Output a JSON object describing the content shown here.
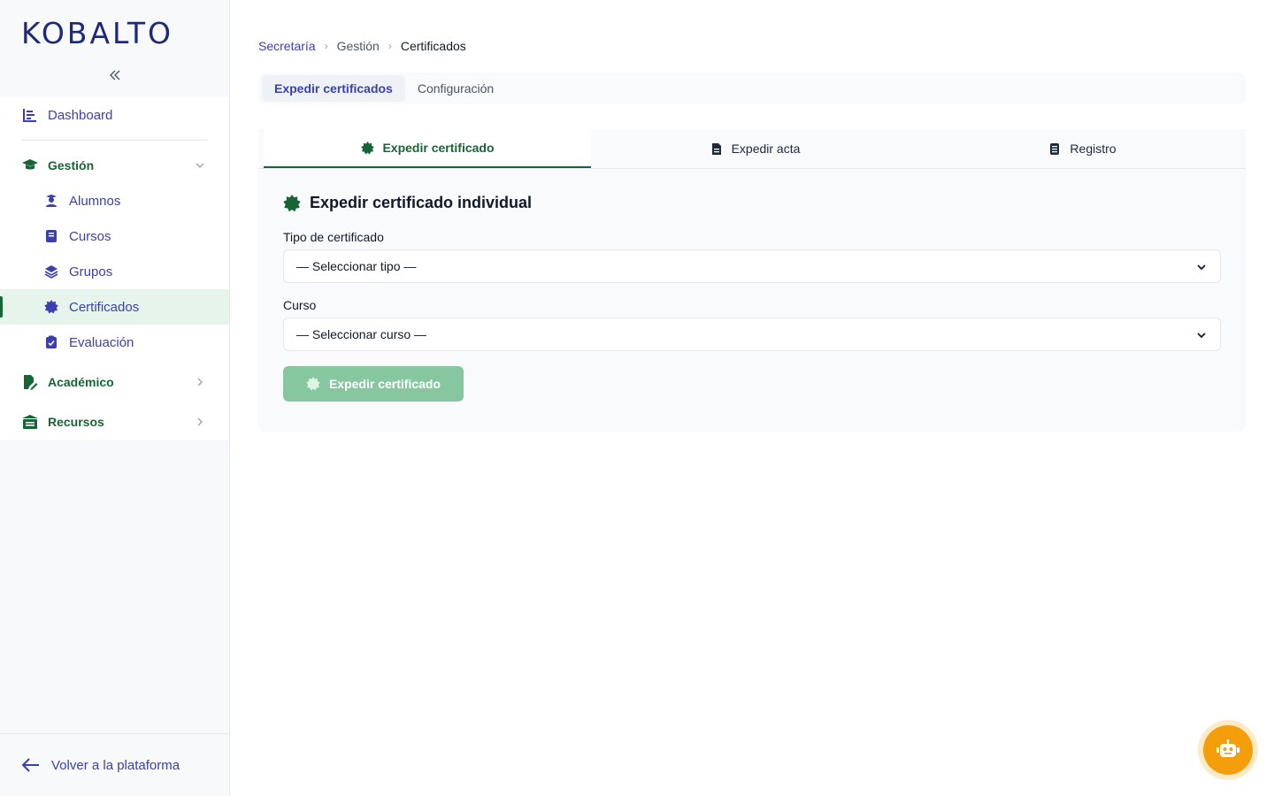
{
  "brand": {
    "logo_text": "KOBALTO"
  },
  "sidebar": {
    "collapse_label": "«",
    "dashboard": "Dashboard",
    "gestion": {
      "label": "Gestión",
      "items": [
        {
          "label": "Alumnos",
          "icon": "user-graduate-icon"
        },
        {
          "label": "Cursos",
          "icon": "book-icon"
        },
        {
          "label": "Grupos",
          "icon": "layers-icon"
        },
        {
          "label": "Certificados",
          "icon": "certificate-icon",
          "active": true
        },
        {
          "label": "Evaluación",
          "icon": "clipboard-check-icon"
        }
      ]
    },
    "academico": {
      "label": "Académico"
    },
    "recursos": {
      "label": "Recursos"
    },
    "back_label": "Volver a la plataforma"
  },
  "breadcrumb": {
    "root": "Secretaría",
    "mid": "Gestión",
    "current": "Certificados"
  },
  "top_tabs": {
    "tab1": "Expedir certificados",
    "tab2": "Configuración"
  },
  "sub_tabs": {
    "tab1": "Expedir certificado",
    "tab2": "Expedir acta",
    "tab3": "Registro"
  },
  "form": {
    "title": "Expedir certificado individual",
    "tipo_label": "Tipo de certificado",
    "tipo_value": "— Seleccionar tipo —",
    "curso_label": "Curso",
    "curso_value": "— Seleccionar curso —",
    "submit_label": "Expedir certificado"
  },
  "colors": {
    "brand": "#1e2a78",
    "accent_green": "#166534",
    "link": "#3b3fb0",
    "button_disabled": "#86c7a0",
    "bot": "#f59e0b"
  }
}
